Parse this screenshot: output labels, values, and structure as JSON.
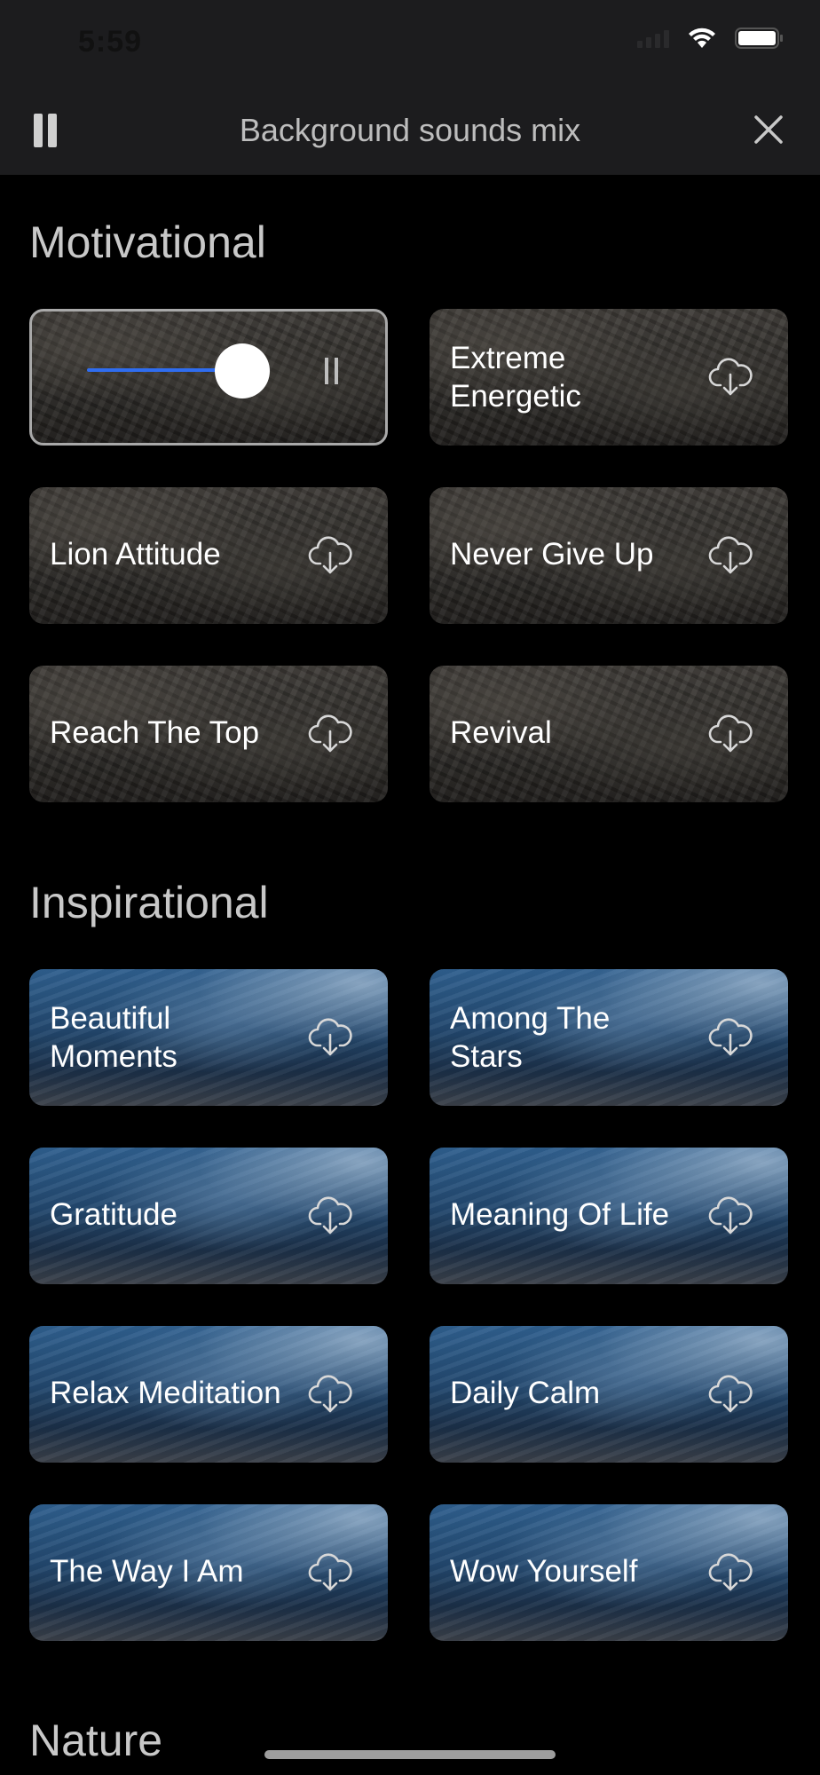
{
  "status_bar": {
    "time": "5:59"
  },
  "header": {
    "title": "Background sounds mix"
  },
  "sections": [
    {
      "title": "Motivational",
      "tiles": [
        {
          "label": "",
          "state": "playing",
          "volume_percent": 80
        },
        {
          "label": "Extreme Energetic"
        },
        {
          "label": "Lion Attitude"
        },
        {
          "label": "Never Give Up"
        },
        {
          "label": "Reach The Top"
        },
        {
          "label": "Revival"
        }
      ]
    },
    {
      "title": "Inspirational",
      "tiles": [
        {
          "label": "Beautiful Moments"
        },
        {
          "label": "Among The Stars"
        },
        {
          "label": "Gratitude"
        },
        {
          "label": "Meaning Of Life"
        },
        {
          "label": "Relax Meditation"
        },
        {
          "label": "Daily Calm"
        },
        {
          "label": "The Way I Am"
        },
        {
          "label": "Wow Yourself"
        }
      ]
    },
    {
      "title": "Nature"
    }
  ],
  "icons": {
    "pause": "pause-icon",
    "close": "close-icon",
    "download": "cloud-download-icon"
  },
  "colors": {
    "accent": "#2f6df0",
    "background": "#000000",
    "header": "#1c1c1e"
  }
}
